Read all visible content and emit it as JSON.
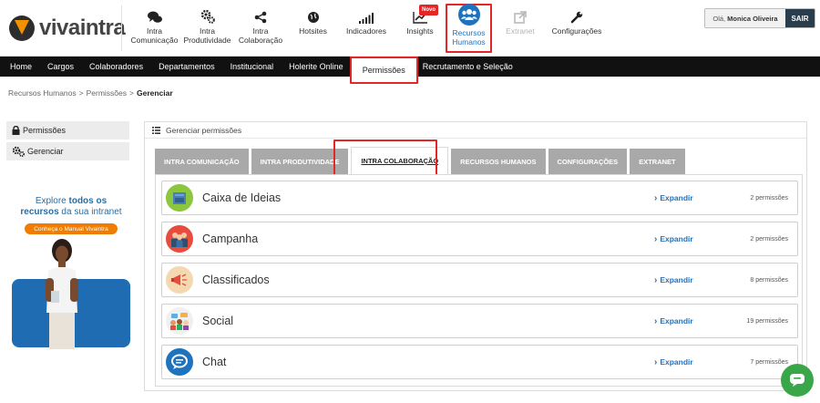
{
  "header": {
    "logo_text": "vivaintra",
    "modules": [
      {
        "label": "Intra Comunicação",
        "icon": "chat-bubbles-icon"
      },
      {
        "label": "Intra Produtividade",
        "icon": "gears-icon"
      },
      {
        "label": "Intra Colaboração",
        "icon": "share-icon"
      },
      {
        "label": "Hotsites",
        "icon": "globe-icon"
      },
      {
        "label": "Indicadores",
        "icon": "signal-bars-icon"
      },
      {
        "label": "Insights",
        "icon": "trend-chart-icon",
        "badge": "Novo"
      },
      {
        "label": "Recursos Humanos",
        "icon": "people-group-icon",
        "active": true
      },
      {
        "label": "Extranet",
        "icon": "external-link-icon",
        "disabled": true
      },
      {
        "label": "Configurações",
        "icon": "wrench-icon"
      }
    ],
    "user_greeting": "Olá,",
    "user_name": "Monica Oliveira",
    "logout_label": "SAIR"
  },
  "nav": {
    "items": [
      "Home",
      "Cargos",
      "Colaboradores",
      "Departamentos",
      "Institucional",
      "Holerite Online",
      "Permissões",
      "Recrutamento e Seleção"
    ],
    "active": "Permissões"
  },
  "breadcrumb": {
    "items": [
      "Recursos Humanos",
      "Permissões"
    ],
    "current": "Gerenciar",
    "separator": ">"
  },
  "sidebar": {
    "items": [
      {
        "label": "Permissões",
        "icon": "lock-icon"
      },
      {
        "label": "Gerenciar",
        "icon": "gears-icon"
      }
    ]
  },
  "promo": {
    "line1_pre": "Explore",
    "line1_bold": "todos os",
    "line2_bold": "recursos",
    "line2_post": "da sua intranet",
    "button_label": "Conheça o Manual Vivaintra"
  },
  "panel": {
    "title": "Gerenciar permissões",
    "tabs": [
      "INTRA COMUNICAÇÃO",
      "INTRA PRODUTIVIDADE",
      "INTRA COLABORAÇÃO",
      "RECURSOS HUMANOS",
      "CONFIGURAÇÕES",
      "EXTRANET"
    ],
    "active_tab": "INTRA COLABORAÇÃO",
    "expand_label": "Expandir",
    "rows": [
      {
        "title": "Caixa de Ideias",
        "count": "2 permissões",
        "icon": "ideas-box-icon",
        "color": "#8cc63f"
      },
      {
        "title": "Campanha",
        "count": "2 permissões",
        "icon": "campaign-people-icon",
        "color": "#e74c3c"
      },
      {
        "title": "Classificados",
        "count": "8 permissões",
        "icon": "megaphone-icon",
        "color": "#f4d9b0"
      },
      {
        "title": "Social",
        "count": "19 permissões",
        "icon": "social-people-icon",
        "color": "#f0f0f0"
      },
      {
        "title": "Chat",
        "count": "7 permissões",
        "icon": "chat-icon",
        "color": "#1e73be"
      }
    ]
  },
  "colors": {
    "accent": "#1e73be",
    "highlight": "#e32626",
    "nav_bg": "#111111",
    "tab_inactive": "#a9a9a9",
    "chat_fab": "#3aa64a"
  }
}
